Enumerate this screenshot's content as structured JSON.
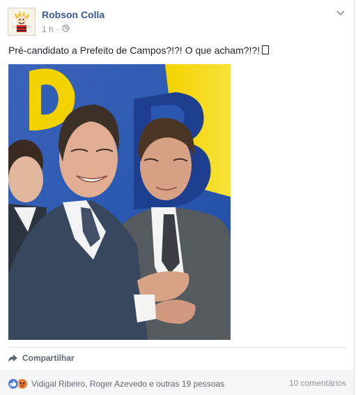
{
  "post": {
    "author": "Robson Colla",
    "time": "1 h",
    "separator": "·",
    "privacy_icon": "globe-icon",
    "menu_icon": "chevron-down-icon",
    "text": "Pré-candidato a Prefeito de Campos?!?! O que acham?!?!",
    "photo_banner_text": "DB"
  },
  "actions": {
    "share_label": "Compartilhar",
    "share_icon": "share-arrow-icon"
  },
  "footer": {
    "reaction_icons": [
      "like-icon",
      "angry-icon"
    ],
    "reaction_names": "Vidigal Ribeiro, Roger Azevedo e outras 19 pessoas",
    "comments": "10 comentários"
  },
  "colors": {
    "link": "#365899",
    "muted": "#90949c",
    "action": "#616770",
    "like": "#4f7ce0",
    "angry": "#f27d3b",
    "footer_bg": "#f6f7f9"
  }
}
